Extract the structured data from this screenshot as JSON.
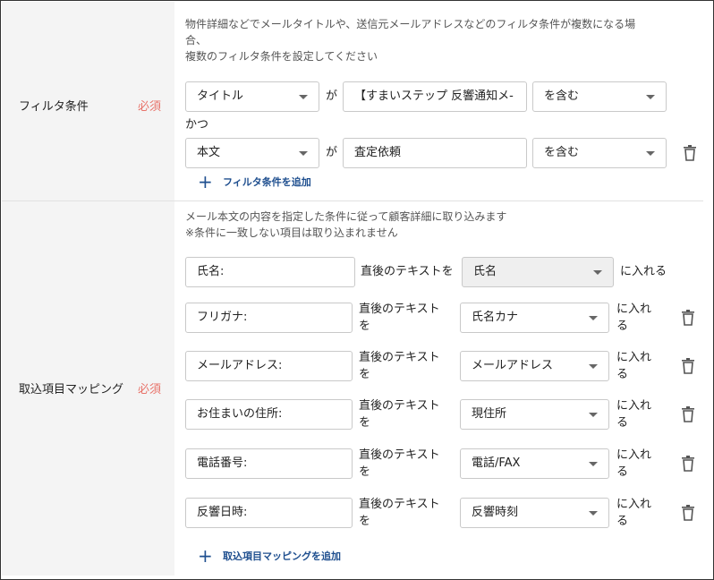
{
  "filter": {
    "label": "フィルタ条件",
    "required": "必須",
    "hint_line1": "物件詳細などでメールタイトルや、送信元メールアドレスなどのフィルタ条件が複数になる場",
    "hint_line2": "合、",
    "hint_line3": "複数のフィルタ条件を設定してください",
    "connector_ga": "が",
    "and_label": "かつ",
    "rows": [
      {
        "field": "タイトル",
        "value": "【すまいステップ 反響通知メ-",
        "operator": "を含む"
      },
      {
        "field": "本文",
        "value": "査定依頼",
        "operator": "を含む"
      }
    ],
    "add_label": "フィルタ条件を追加"
  },
  "mapping": {
    "label": "取込項目マッピング",
    "required": "必須",
    "hint_line1": "メール本文の内容を指定した条件に従って顧客詳細に取り込みます",
    "hint_line2": "※条件に一致しない項目は取り込まれません",
    "first_row": {
      "keyword": "氏名:",
      "after_text": "直後のテキストを",
      "target": "氏名",
      "put_in": "に入れる"
    },
    "rows": [
      {
        "keyword": "フリガナ:",
        "after_text_1": "直後のテキスト",
        "after_text_2": "を",
        "target": "氏名カナ",
        "put_in_1": "に入れ",
        "put_in_2": "る"
      },
      {
        "keyword": "メールアドレス:",
        "after_text_1": "直後のテキスト",
        "after_text_2": "を",
        "target": "メールアドレス",
        "put_in_1": "に入れ",
        "put_in_2": "る"
      },
      {
        "keyword": "お住まいの住所:",
        "after_text_1": "直後のテキスト",
        "after_text_2": "を",
        "target": "現住所",
        "put_in_1": "に入れ",
        "put_in_2": "る"
      },
      {
        "keyword": "電話番号:",
        "after_text_1": "直後のテキスト",
        "after_text_2": "を",
        "target": "電話/FAX",
        "put_in_1": "に入れ",
        "put_in_2": "る"
      },
      {
        "keyword": "反響日時:",
        "after_text_1": "直後のテキスト",
        "after_text_2": "を",
        "target": "反響時刻",
        "put_in_1": "に入れ",
        "put_in_2": "る"
      }
    ],
    "add_label": "取込項目マッピングを追加"
  },
  "icons": {
    "delete": "trash-icon",
    "add": "plus-icon",
    "dropdown": "caret-down-icon"
  },
  "colors": {
    "required": "#e8736a",
    "link": "#1f4f8f",
    "label_bg": "#f4f4f4"
  }
}
